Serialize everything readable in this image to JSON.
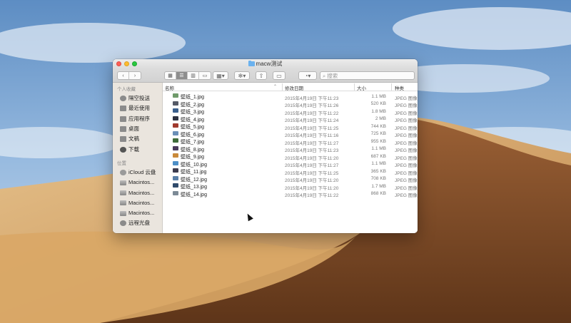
{
  "window": {
    "title": "macw测试"
  },
  "toolbar": {
    "back_label": "‹",
    "forward_label": "›",
    "search_placeholder": "搜索"
  },
  "sidebar": {
    "personal_header": "个人收藏",
    "personal_items": [
      "隔空投送",
      "最近使用",
      "应用程序",
      "桌面",
      "文稿",
      "下载"
    ],
    "location_header": "位置",
    "location_items": [
      "iCloud 云盘",
      "Macintos...",
      "Macintos...",
      "Macintos...",
      "Macintos...",
      "远程光盘"
    ]
  },
  "columns": {
    "name": "名称",
    "date": "修改日期",
    "size": "大小",
    "kind": "种类"
  },
  "files": [
    {
      "name": "壁纸_1.jpg",
      "date": "2015年4月19日 下午11:23",
      "size": "1.1 MB",
      "kind": "JPEG 图像",
      "color": "#6f9a6a"
    },
    {
      "name": "壁纸_2.jpg",
      "date": "2015年4月19日 下午11:26",
      "size": "520 KB",
      "kind": "JPEG 图像",
      "color": "#555a66"
    },
    {
      "name": "壁纸_3.jpg",
      "date": "2015年4月19日 下午11:22",
      "size": "1.8 MB",
      "kind": "JPEG 图像",
      "color": "#3a5f8c"
    },
    {
      "name": "壁纸_4.jpg",
      "date": "2015年4月19日 下午11:24",
      "size": "2 MB",
      "kind": "JPEG 图像",
      "color": "#2d3240"
    },
    {
      "name": "壁纸_5.jpg",
      "date": "2015年4月19日 下午11:25",
      "size": "744 KB",
      "kind": "JPEG 图像",
      "color": "#a03a2e"
    },
    {
      "name": "壁纸_6.jpg",
      "date": "2015年4月19日 下午11:16",
      "size": "725 KB",
      "kind": "JPEG 图像",
      "color": "#6b8fb8"
    },
    {
      "name": "壁纸_7.jpg",
      "date": "2015年4月19日 下午11:27",
      "size": "955 KB",
      "kind": "JPEG 图像",
      "color": "#3e6b3a"
    },
    {
      "name": "壁纸_8.jpg",
      "date": "2015年4月19日 下午11:23",
      "size": "1.1 MB",
      "kind": "JPEG 图像",
      "color": "#4a3a5c"
    },
    {
      "name": "壁纸_9.jpg",
      "date": "2015年4月19日 下午11:20",
      "size": "687 KB",
      "kind": "JPEG 图像",
      "color": "#c98a3a"
    },
    {
      "name": "壁纸_10.jpg",
      "date": "2015年4月19日 下午11:27",
      "size": "1.1 MB",
      "kind": "JPEG 图像",
      "color": "#4d8fc7"
    },
    {
      "name": "壁纸_11.jpg",
      "date": "2015年4月19日 下午11:25",
      "size": "365 KB",
      "kind": "JPEG 图像",
      "color": "#3b3b4e"
    },
    {
      "name": "壁纸_12.jpg",
      "date": "2015年4月19日 下午11:20",
      "size": "708 KB",
      "kind": "JPEG 图像",
      "color": "#5a7fa8"
    },
    {
      "name": "壁纸_13.jpg",
      "date": "2015年4月19日 下午11:20",
      "size": "1.7 MB",
      "kind": "JPEG 图像",
      "color": "#2f4a6b"
    },
    {
      "name": "壁纸_14.jpg",
      "date": "2015年4月19日 下午11:22",
      "size": "868 KB",
      "kind": "JPEG 图像",
      "color": "#7c8a96"
    }
  ]
}
